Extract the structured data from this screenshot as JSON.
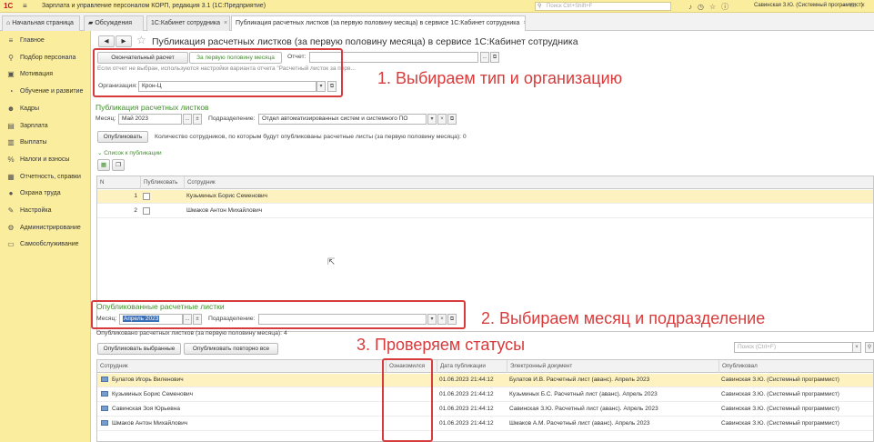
{
  "titlebar": {
    "logo": "1С",
    "menu_glyph": "≡",
    "title": "Зарплата и управление персоналом КОРП, редакция 3.1  (1С:Предприятие)",
    "search_placeholder": "Поиск Ctrl+Shift+F",
    "user": "Савинская З.Ю. (Системный программист)"
  },
  "tabs": [
    {
      "label": "Начальная страница"
    },
    {
      "label": "Обсуждения"
    },
    {
      "label": "1С:Кабинет сотрудника"
    },
    {
      "label": "Публикация расчетных листков (за первую половину месяца) в сервисе 1С:Кабинет сотрудника"
    }
  ],
  "sidebar": {
    "items": [
      {
        "label": "Главное",
        "icon": "≡"
      },
      {
        "label": "Подбор персонала",
        "icon": "⚲"
      },
      {
        "label": "Мотивация",
        "icon": "▣"
      },
      {
        "label": "Обучение и развитие",
        "icon": "◔"
      },
      {
        "label": "Кадры",
        "icon": "☻"
      },
      {
        "label": "Зарплата",
        "icon": "▤"
      },
      {
        "label": "Выплаты",
        "icon": "▥"
      },
      {
        "label": "Налоги и взносы",
        "icon": "%"
      },
      {
        "label": "Отчетность, справки",
        "icon": "▦"
      },
      {
        "label": "Охрана труда",
        "icon": "●"
      },
      {
        "label": "Настройка",
        "icon": "✎"
      },
      {
        "label": "Администрирование",
        "icon": "⚙"
      },
      {
        "label": "Самообслуживание",
        "icon": "▭"
      }
    ]
  },
  "page": {
    "title": "Публикация расчетных листков (за первую половину месяца) в сервисе 1С:Кабинет сотрудника",
    "nav_back": "◀",
    "nav_forward": "▶",
    "star": "☆",
    "btn_final": "Окончательный расчет",
    "btn_half": "За первую половину месяца",
    "report_label": "Отчет:",
    "report_value": "",
    "hint": "Если отчет не выбран, используются настройки варианта отчета \"Расчетный листок за перв...",
    "org_label": "Организация:",
    "org_value": "Крон-Ц"
  },
  "publish": {
    "heading": "Публикация расчетных листков",
    "month_label": "Месяц:",
    "month_value": "Май 2023",
    "dept_label": "Подразделение:",
    "dept_value": "Отдел автоматизированных систем и системного ПО",
    "btn_publish": "Опубликовать",
    "count_text": "Количество сотрудников, по которым будут опубликованы расчетные листы (за первую половину месяца): 0",
    "list_toggle": "Список к публикации",
    "grid_headers": [
      "N",
      "Публиковать",
      "Сотрудник"
    ],
    "rows": [
      {
        "n": "1",
        "employee": "Кузьминых Борис Семенович"
      },
      {
        "n": "2",
        "employee": "Шмаков Антон Михайлович"
      }
    ]
  },
  "published": {
    "heading": "Опубликованные расчетные листки",
    "month_label": "Месяц:",
    "month_value": "Апрель 2023",
    "dept_label": "Подразделение:",
    "dept_value": "",
    "count_text": "Опубликовано расчетных листков (за первую половину месяца): 4",
    "btn_selected": "Опубликовать выбранные",
    "btn_again": "Опубликовать повторно все",
    "search_placeholder": "Поиск (Ctrl+F)",
    "grid_headers": [
      "Сотрудник",
      "Ознакомился",
      "Дата публикации",
      "Электронный документ",
      "Опубликовал"
    ],
    "rows": [
      {
        "employee": "Булатов Игорь Виленович",
        "acquainted": "",
        "date": "01.06.2023 21:44:12",
        "doc": "Булатов И.В. Расчетный лист (аванс). Апрель 2023",
        "by": "Савинская З.Ю. (Системный программист)"
      },
      {
        "employee": "Кузьминых Борис Семенович",
        "acquainted": "",
        "date": "01.06.2023 21:44:12",
        "doc": "Кузьминых Б.С. Расчетный лист (аванс). Апрель 2023",
        "by": "Савинская З.Ю. (Системный программист)"
      },
      {
        "employee": "Савинская Зоя Юрьевна",
        "acquainted": "",
        "date": "01.06.2023 21:44:12",
        "doc": "Савинская З.Ю. Расчетный лист (аванс). Апрель 2023",
        "by": "Савинская З.Ю. (Системный программист)"
      },
      {
        "employee": "Шмаков Антон Михайлович",
        "acquainted": "",
        "date": "01.06.2023 21:44:12",
        "doc": "Шмаков А.М. Расчетный лист (аванс). Апрель 2023",
        "by": "Савинская З.Ю. (Системный программист)"
      }
    ]
  },
  "annotations": {
    "step1": "1. Выбираем тип и организацию",
    "step2": "2. Выбираем месяц и подразделение",
    "step3": "3. Проверяем статусы"
  },
  "colors": {
    "accent_red": "#d83b3b",
    "panel_yellow": "#fbed9e",
    "heading_green": "#3f8f2a",
    "selected_row": "#fdf2c0"
  }
}
